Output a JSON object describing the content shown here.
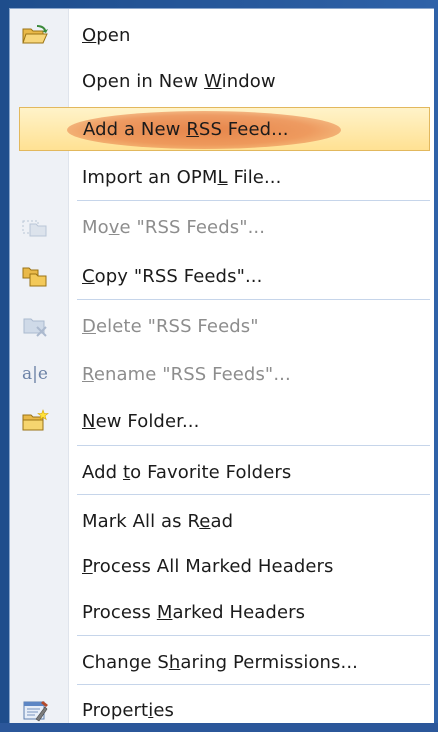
{
  "menu": {
    "items": [
      {
        "pre": "",
        "key": "O",
        "post": "pen",
        "disabled": false,
        "icon": "open-folder-icon"
      },
      {
        "pre": "Open in New ",
        "key": "W",
        "post": "indow",
        "disabled": false,
        "icon": ""
      },
      {
        "pre": "Add a New ",
        "key": "R",
        "post": "SS Feed...",
        "disabled": false,
        "highlighted": true,
        "icon": ""
      },
      {
        "pre": "Import an OPM",
        "key": "L",
        "post": " File...",
        "disabled": false,
        "icon": ""
      },
      {
        "pre": "Mo",
        "key": "v",
        "post": "e \"RSS Feeds\"...",
        "disabled": true,
        "icon": "move-folder-icon"
      },
      {
        "pre": "",
        "key": "C",
        "post": "opy \"RSS Feeds\"...",
        "disabled": false,
        "icon": "copy-folder-icon"
      },
      {
        "pre": "",
        "key": "D",
        "post": "elete \"RSS Feeds\"",
        "disabled": true,
        "icon": "delete-folder-icon"
      },
      {
        "pre": "",
        "key": "R",
        "post": "ename \"RSS Feeds\"...",
        "disabled": true,
        "icon": "rename-icon"
      },
      {
        "pre": "",
        "key": "N",
        "post": "ew Folder...",
        "disabled": false,
        "icon": "new-folder-icon"
      },
      {
        "pre": "Add ",
        "key": "t",
        "post": "o Favorite Folders",
        "disabled": false,
        "icon": ""
      },
      {
        "pre": "Mark All as R",
        "key": "e",
        "post": "ad",
        "disabled": false,
        "icon": ""
      },
      {
        "pre": "",
        "key": "P",
        "post": "rocess All Marked Headers",
        "disabled": false,
        "icon": ""
      },
      {
        "pre": "Process ",
        "key": "M",
        "post": "arked Headers",
        "disabled": false,
        "icon": ""
      },
      {
        "pre": "Change S",
        "key": "h",
        "post": "aring Permissions...",
        "disabled": false,
        "icon": ""
      },
      {
        "pre": "Propert",
        "key": "i",
        "post": "es",
        "disabled": false,
        "icon": "properties-icon"
      }
    ],
    "rename_glyph": "a|e"
  }
}
